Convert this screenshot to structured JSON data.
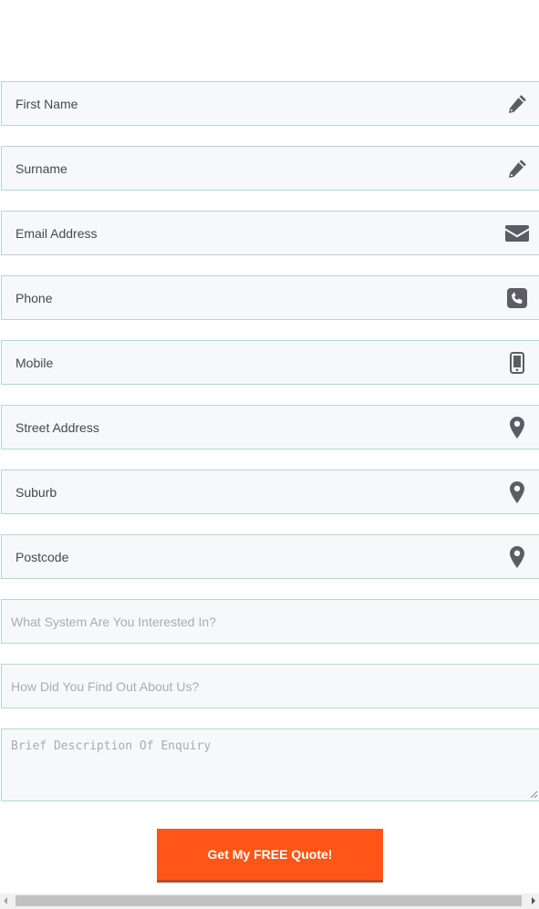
{
  "form": {
    "fields": [
      {
        "label": "First Name",
        "icon": "pencil-icon"
      },
      {
        "label": "Surname",
        "icon": "pencil-icon"
      },
      {
        "label": "Email Address",
        "icon": "envelope-icon"
      },
      {
        "label": "Phone",
        "icon": "phone-square-icon"
      },
      {
        "label": "Mobile",
        "icon": "mobile-icon"
      },
      {
        "label": "Street Address",
        "icon": "map-marker-icon"
      },
      {
        "label": "Suburb",
        "icon": "map-marker-icon"
      },
      {
        "label": "Postcode",
        "icon": "map-marker-icon"
      }
    ],
    "system_placeholder": "What System Are You Interested In?",
    "source_placeholder": "How Did You Find Out About Us?",
    "description_placeholder": "Brief Description Of Enquiry",
    "submit_label": "Get My FREE Quote!"
  },
  "colors": {
    "field_background": "#f6f8f9",
    "field_border": "#b5d6d6",
    "icon": "#5a5d63",
    "button": "#ff5517"
  }
}
